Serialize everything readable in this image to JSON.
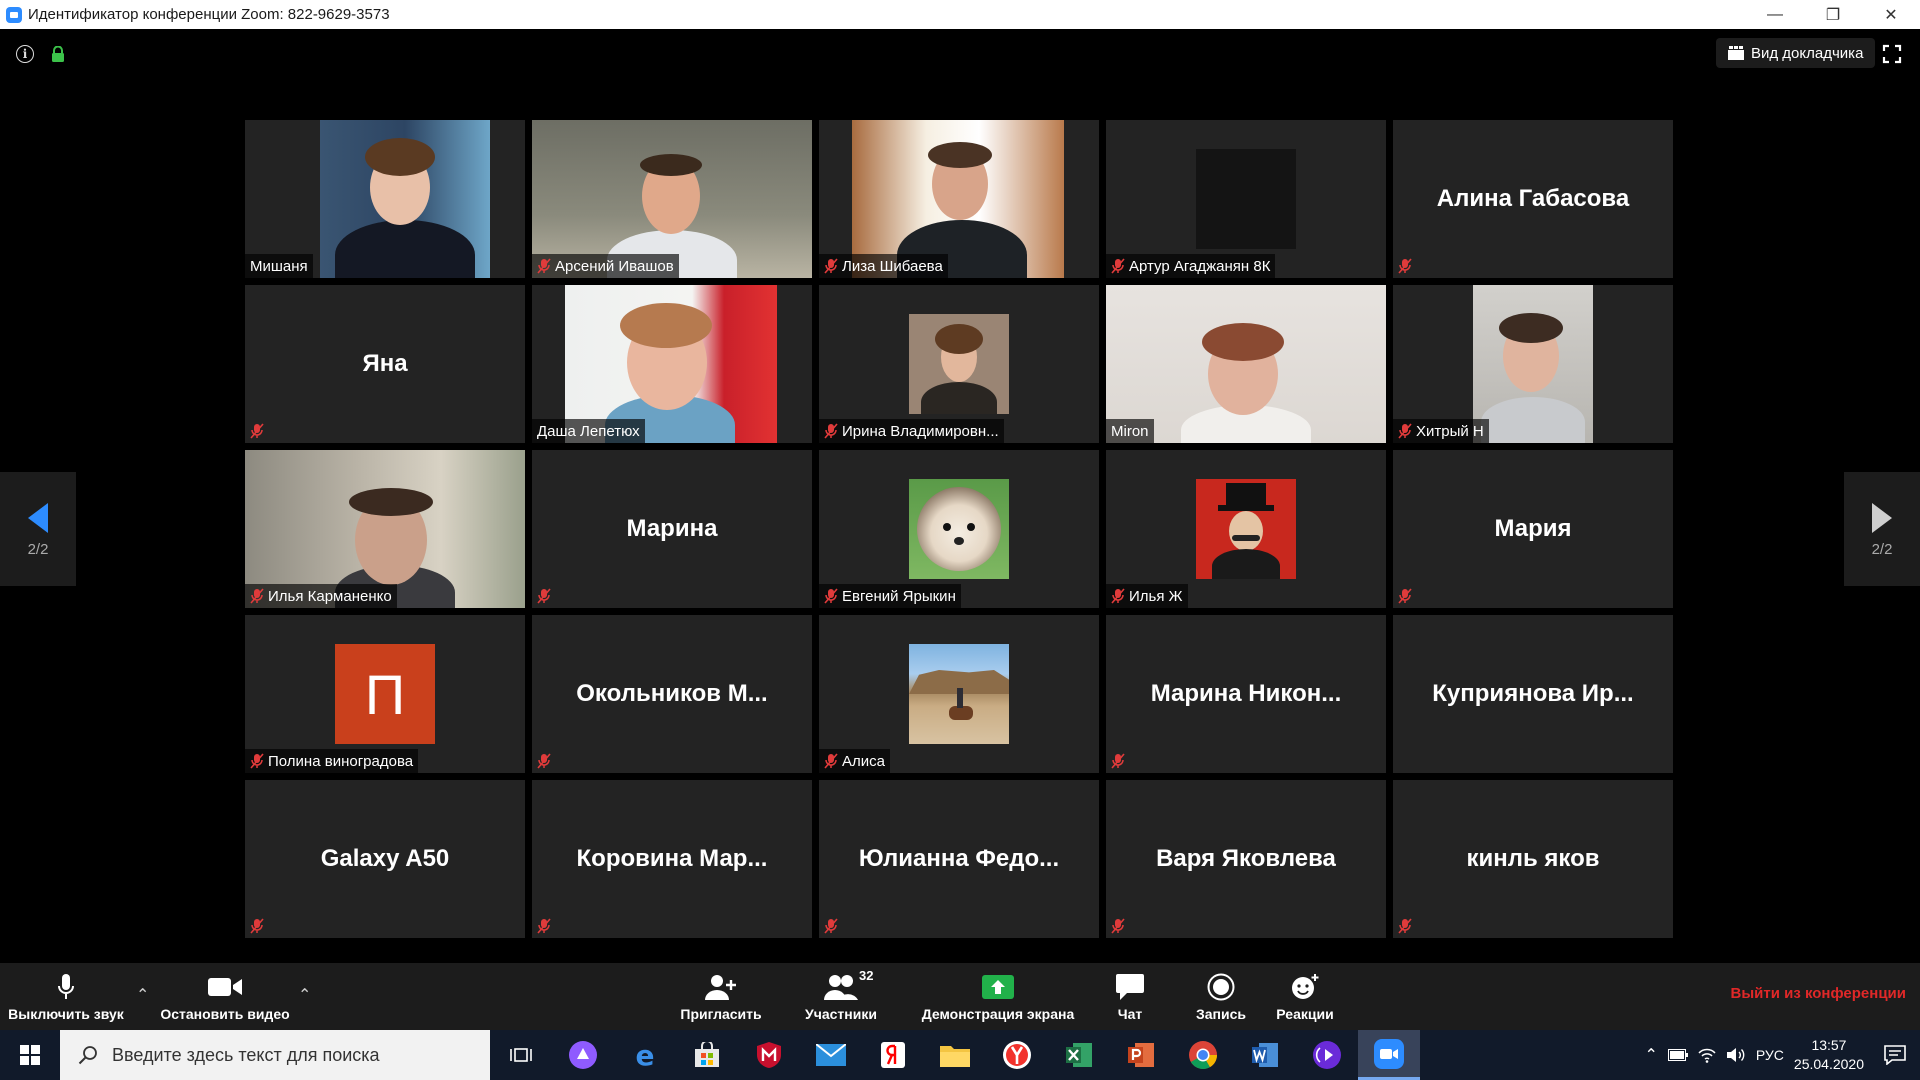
{
  "window": {
    "title": "Идентификатор конференции Zoom: 822-9629-3573"
  },
  "topbar": {
    "speaker_view_label": "Вид докладчика"
  },
  "participants": [
    {
      "name": "Мишаня",
      "video": true,
      "muted": false
    },
    {
      "name": "Арсений Ивашов",
      "video": true,
      "muted": true
    },
    {
      "name": "Лиза Шибаева",
      "video": true,
      "muted": true
    },
    {
      "name": "Артур Агаджанян 8К",
      "video": true,
      "muted": true
    },
    {
      "name": "Алина Габасова",
      "video": false,
      "muted": true
    },
    {
      "name": "Яна",
      "video": false,
      "muted": true
    },
    {
      "name": "Даша Лепетюх",
      "video": true,
      "muted": false
    },
    {
      "name": "Ирина Владимировн...",
      "video": true,
      "muted": true
    },
    {
      "name": "Miron",
      "video": true,
      "muted": false
    },
    {
      "name": "Хитрый Н",
      "video": true,
      "muted": true
    },
    {
      "name": "Илья Карманенко",
      "video": true,
      "muted": true
    },
    {
      "name": "Марина",
      "video": false,
      "muted": true
    },
    {
      "name": "Евгений Ярыкин",
      "video": true,
      "muted": true
    },
    {
      "name": "Илья Ж",
      "video": true,
      "muted": true
    },
    {
      "name": "Мария",
      "video": false,
      "muted": true
    },
    {
      "name": "Полина виноградова",
      "video": true,
      "muted": true,
      "avatar_letter": "П"
    },
    {
      "name": "Окольников М...",
      "video": false,
      "muted": true
    },
    {
      "name": "Алиса",
      "video": true,
      "muted": true
    },
    {
      "name": "Марина Никон...",
      "video": false,
      "muted": true
    },
    {
      "name": "Куприянова Ир...",
      "video": false,
      "muted": false
    },
    {
      "name": "Galaxy A50",
      "video": false,
      "muted": true
    },
    {
      "name": "Коровина Мар...",
      "video": false,
      "muted": true
    },
    {
      "name": "Юлианна Федо...",
      "video": false,
      "muted": true
    },
    {
      "name": "Варя Яковлева",
      "video": false,
      "muted": true
    },
    {
      "name": "кинль яков",
      "video": false,
      "muted": true
    }
  ],
  "pagination": {
    "left": "2/2",
    "right": "2/2"
  },
  "toolbar": {
    "mute_label": "Выключить звук",
    "video_label": "Остановить видео",
    "invite_label": "Пригласить",
    "participants_label": "Участники",
    "participants_count": "32",
    "share_label": "Демонстрация экрана",
    "chat_label": "Чат",
    "record_label": "Запись",
    "reactions_label": "Реакции",
    "leave_label": "Выйти из конференции"
  },
  "taskbar": {
    "search_placeholder": "Введите здесь текст для поиска",
    "language": "РУС",
    "time": "13:57",
    "date": "25.04.2020"
  },
  "colors": {
    "accent": "#2d8cff",
    "leave": "#e02828",
    "tile": "#232323",
    "share_green": "#21b14a"
  }
}
